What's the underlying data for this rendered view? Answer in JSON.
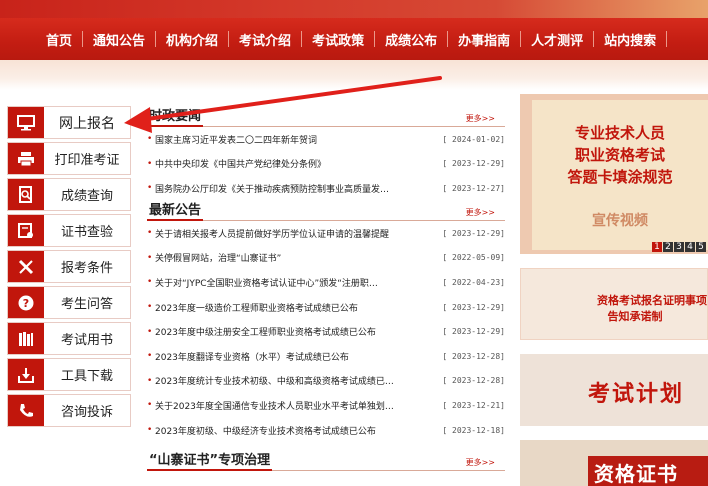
{
  "nav": [
    "首页",
    "通知公告",
    "机构介绍",
    "考试介绍",
    "考试政策",
    "成绩公布",
    "办事指南",
    "人才测评",
    "站内搜索"
  ],
  "side": [
    {
      "label": "网上报名",
      "icon": "monitor-icon"
    },
    {
      "label": "打印准考证",
      "icon": "printer-icon"
    },
    {
      "label": "成绩查询",
      "icon": "search-doc-icon"
    },
    {
      "label": "证书查验",
      "icon": "certificate-icon"
    },
    {
      "label": "报考条件",
      "icon": "tools-icon"
    },
    {
      "label": "考生问答",
      "icon": "question-icon"
    },
    {
      "label": "考试用书",
      "icon": "books-icon"
    },
    {
      "label": "工具下载",
      "icon": "download-icon"
    },
    {
      "label": "咨询投诉",
      "icon": "phone-icon"
    }
  ],
  "news1": {
    "title": "时政要闻",
    "more": "更多>>",
    "items": [
      {
        "t": "国家主席习近平发表二〇二四年新年贺词",
        "d": "[ 2024-01-02]"
      },
      {
        "t": "中共中央印发《中国共产党纪律处分条例》",
        "d": "[ 2023-12-29]"
      },
      {
        "t": "国务院办公厅印发《关于推动疾病预防控制事业高质量发…",
        "d": "[ 2023-12-27]"
      }
    ]
  },
  "news2": {
    "title": "最新公告",
    "more": "更多>>",
    "items": [
      {
        "t": "关于请相关报考人员提前做好学历学位认证申请的温馨提醒",
        "d": "[ 2023-12-29]"
      },
      {
        "t": "关停假冒网站，治理“山寨证书”",
        "d": "[ 2022-05-09]"
      },
      {
        "t": "关于对“JYPC全国职业资格考试认证中心”颁发“注册职…",
        "d": "[ 2022-04-23]"
      },
      {
        "t": "2023年度一级造价工程师职业资格考试成绩已公布",
        "d": "[ 2023-12-29]"
      },
      {
        "t": "2023年度中级注册安全工程师职业资格考试成绩已公布",
        "d": "[ 2023-12-29]"
      },
      {
        "t": "2023年度翻译专业资格（水平）考试成绩已公布",
        "d": "[ 2023-12-28]"
      },
      {
        "t": "2023年度统计专业技术初级、中级和高级资格考试成绩已…",
        "d": "[ 2023-12-28]"
      },
      {
        "t": "关于2023年度全国通信专业技术人员职业水平考试单独划…",
        "d": "[ 2023-12-21]"
      },
      {
        "t": "2023年度初级、中级经济专业技术资格考试成绩已公布",
        "d": "[ 2023-12-18]"
      }
    ]
  },
  "news3": {
    "title": "“山寨证书”专项治理",
    "more": "更多>>"
  },
  "banner1": {
    "lines": [
      "专业技术人员",
      "职业资格考试",
      "答题卡填涂规范"
    ],
    "video": "宣传视频",
    "pages": [
      "1",
      "2",
      "3",
      "4",
      "5"
    ]
  },
  "banner2": {
    "l1": "资格考试报名证明事项",
    "l2": "告知承诺制"
  },
  "banner3": {
    "t": "考试计划"
  },
  "banner4": {
    "t": "资格证书"
  },
  "colors": {
    "primary": "#c1160c",
    "nav": "#c31d12"
  }
}
